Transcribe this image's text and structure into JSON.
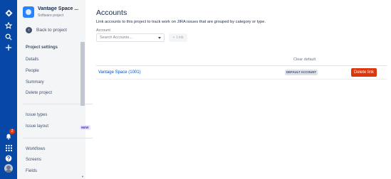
{
  "colors": {
    "global_nav": "#0747a6",
    "sidebar_bg": "#f4f5f7",
    "link": "#0052cc",
    "danger": "#de350b"
  },
  "global_nav": {
    "icons": [
      "jira-logo-icon",
      "star-icon",
      "search-icon",
      "plus-icon",
      "notifications-icon",
      "app-switcher-icon",
      "help-icon",
      "avatar"
    ],
    "notification_count": "2"
  },
  "sidebar": {
    "project_name": "Vantage Space ...",
    "project_type": "Software project",
    "back_label": "Back to project",
    "section_title": "Project settings",
    "items": [
      {
        "label": "Details"
      },
      {
        "label": "People"
      },
      {
        "label": "Summary"
      },
      {
        "label": "Delete project"
      },
      {
        "label": "Issue types"
      },
      {
        "label": "Issue layout"
      },
      {
        "label": "Workflows"
      },
      {
        "label": "Screens"
      },
      {
        "label": "Fields"
      }
    ],
    "new_badge": "NEW"
  },
  "main": {
    "title": "Accounts",
    "description": "Link accounts to this project to track work on JIRA issues that are grouped by category or type.",
    "account_label": "Account",
    "search_placeholder": "Search Accounts...",
    "link_button": "Link",
    "clear_default_header": "Clear default",
    "rows": [
      {
        "account": "Vantage Space (1001)",
        "badge": "DEFAULT ACCOUNT",
        "action": "Delete link"
      }
    ]
  }
}
